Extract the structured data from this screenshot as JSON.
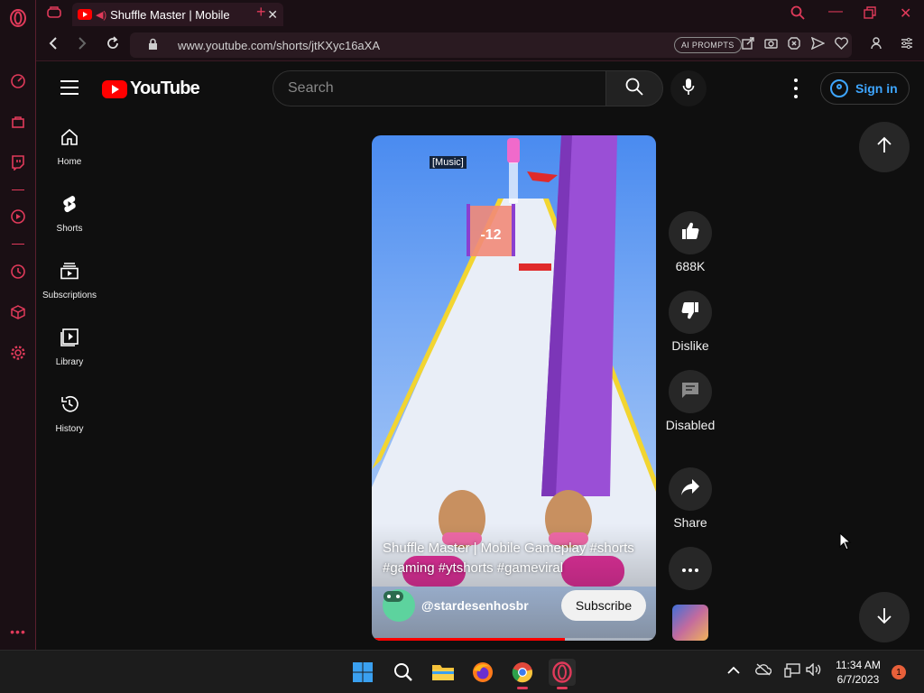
{
  "browser": {
    "tab_title": "Shuffle Master | Mobile",
    "url": "www.youtube.com/shorts/jtKXyc16aXA",
    "ai_prompts_label": "AI PROMPTS"
  },
  "youtube": {
    "logo_text": "YouTube",
    "search_placeholder": "Search",
    "signin_label": "Sign in",
    "guide": [
      {
        "label": "Home",
        "icon": "home-icon"
      },
      {
        "label": "Shorts",
        "icon": "shorts-icon"
      },
      {
        "label": "Subscriptions",
        "icon": "subscriptions-icon"
      },
      {
        "label": "Library",
        "icon": "library-icon"
      },
      {
        "label": "History",
        "icon": "history-icon"
      }
    ]
  },
  "short": {
    "caption_tag": "[Music]",
    "title": "Shuffle Master | Mobile Gameplay #shorts #gaming #ytshorts #gameviral",
    "channel": "@stardesenhosbr",
    "subscribe_label": "Subscribe",
    "gate_value": "-12",
    "progress_fraction": 0.68,
    "likes": "688K",
    "dislike_label": "Dislike",
    "comments_label": "Disabled",
    "share_label": "Share"
  },
  "taskbar": {
    "time": "11:34 AM",
    "date": "6/7/2023",
    "notification_count": "1"
  },
  "colors": {
    "opera_accent": "#e03a5a",
    "youtube_red": "#ff0000",
    "link_blue": "#3ea6ff"
  }
}
